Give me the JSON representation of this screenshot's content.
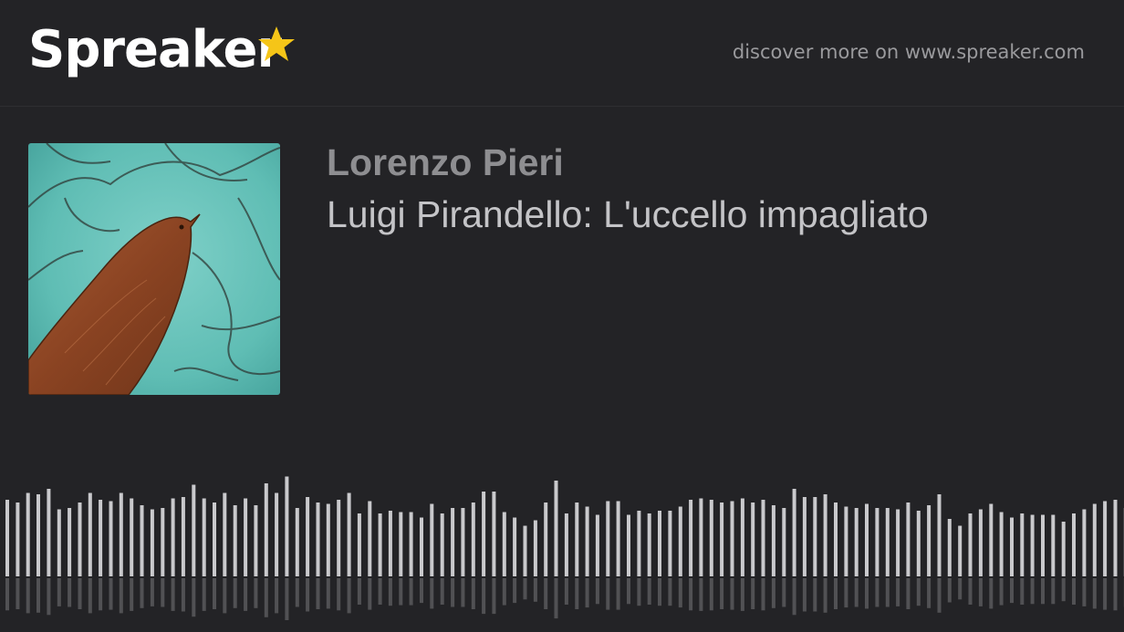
{
  "header": {
    "brand": "Spreaker",
    "logo_icon": "star-icon",
    "discover_text": "discover more on www.spreaker.com"
  },
  "episode": {
    "author": "Lorenzo Pieri",
    "title": "Luigi Pirandello: L'uccello impagliato",
    "cover_description_icon": "bird-artwork"
  },
  "colors": {
    "background": "#232326",
    "star": "#f5c518",
    "waveform": "#c9c9cc"
  },
  "waveform": {
    "levels": [
      0.56,
      0.54,
      0.61,
      0.6,
      0.64,
      0.49,
      0.5,
      0.54,
      0.61,
      0.56,
      0.55,
      0.61,
      0.57,
      0.52,
      0.49,
      0.5,
      0.57,
      0.58,
      0.67,
      0.57,
      0.54,
      0.61,
      0.52,
      0.57,
      0.52,
      0.68,
      0.61,
      0.73,
      0.5,
      0.58,
      0.54,
      0.53,
      0.56,
      0.61,
      0.46,
      0.55,
      0.46,
      0.48,
      0.47,
      0.47,
      0.43,
      0.53,
      0.46,
      0.5,
      0.5,
      0.54,
      0.62,
      0.62,
      0.47,
      0.43,
      0.37,
      0.41,
      0.54,
      0.7,
      0.46,
      0.54,
      0.51,
      0.45,
      0.55,
      0.55,
      0.45,
      0.48,
      0.46,
      0.48,
      0.48,
      0.51,
      0.56,
      0.57,
      0.56,
      0.54,
      0.55,
      0.57,
      0.54,
      0.56,
      0.52,
      0.5,
      0.64,
      0.58,
      0.58,
      0.6,
      0.54,
      0.51,
      0.5,
      0.53,
      0.5,
      0.5,
      0.49,
      0.54,
      0.48,
      0.52,
      0.6,
      0.42,
      0.37,
      0.46,
      0.49,
      0.53,
      0.47,
      0.43,
      0.46,
      0.45,
      0.45,
      0.45,
      0.4,
      0.46,
      0.49,
      0.53,
      0.55,
      0.56,
      0.5
    ]
  }
}
